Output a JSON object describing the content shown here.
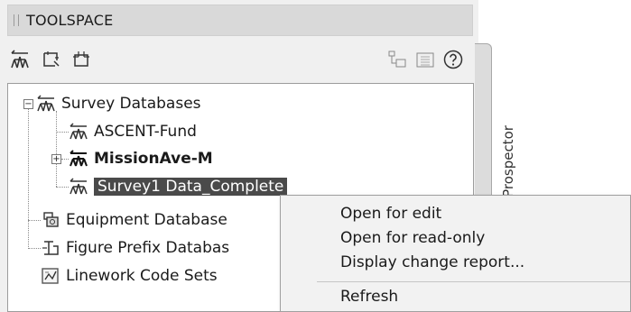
{
  "window": {
    "title": "TOOLSPACE"
  },
  "toolbar": {
    "icons": [
      "survey-points-icon",
      "select-region-icon",
      "select-window-icon",
      "tree-view-icon",
      "item-view-icon",
      "help-icon"
    ]
  },
  "side_tab": {
    "label": "Prospector"
  },
  "tree": {
    "root": {
      "label": "Survey Databases",
      "expander": "−"
    },
    "databases": [
      {
        "label": "ASCENT-Fund"
      },
      {
        "label": "MissionAve-M",
        "expander": "+"
      },
      {
        "label": "Survey1 Data_Complete"
      }
    ],
    "other_items": [
      {
        "label": "Equipment Database"
      },
      {
        "label": "Figure Prefix Databas"
      },
      {
        "label": "Linework Code Sets"
      }
    ]
  },
  "context_menu": {
    "items": [
      {
        "label": "Open for edit"
      },
      {
        "label": "Open for read-only"
      },
      {
        "label": "Display change report..."
      },
      {
        "label": "Refresh"
      }
    ]
  },
  "colors": {
    "selection": "#4a4a4a",
    "panel_bg": "#f0f0f0",
    "titlebar_bg": "#d9d9d9"
  }
}
